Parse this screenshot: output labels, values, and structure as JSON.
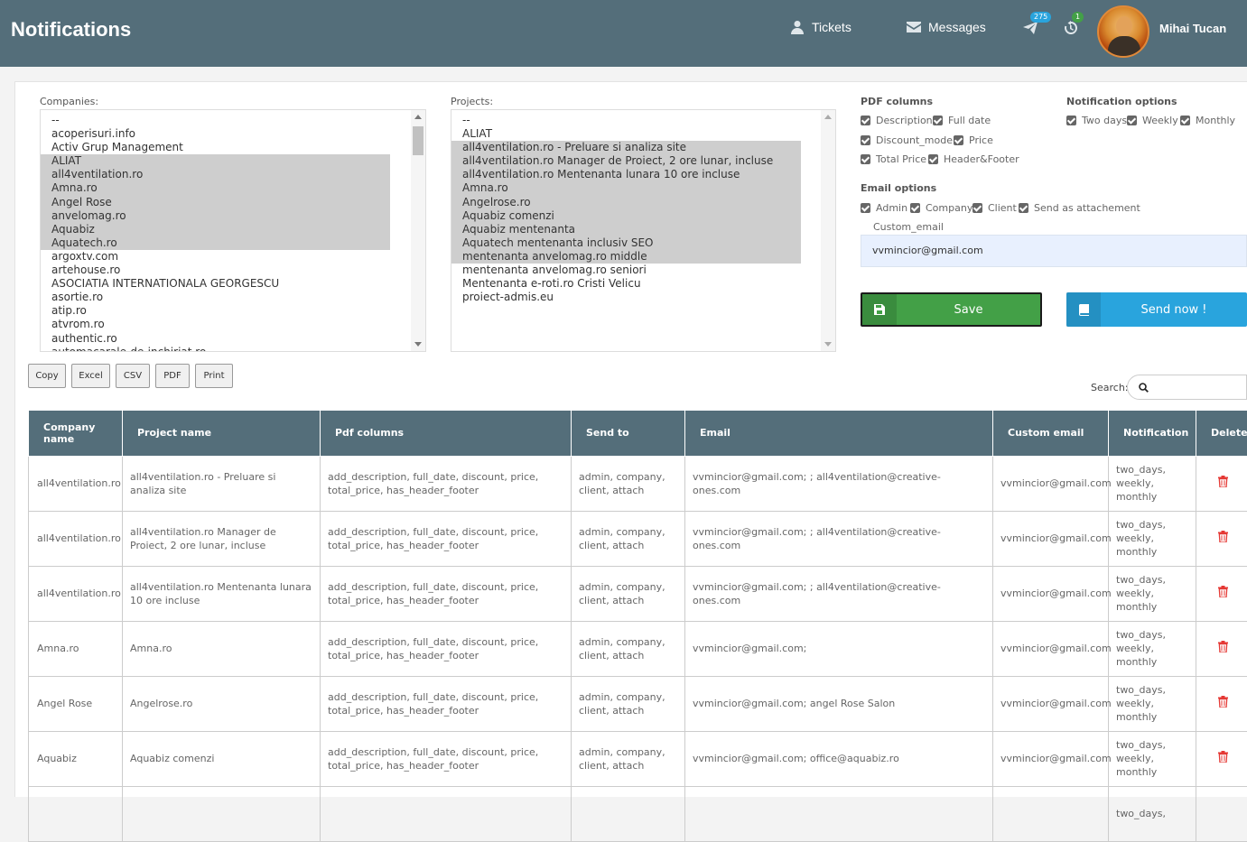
{
  "header": {
    "title": "Notifications",
    "tickets_label": "Tickets",
    "messages_label": "Messages",
    "tasks_badge": "275",
    "history_badge": "1",
    "username": "Mihai Tucan"
  },
  "companies": {
    "label": "Companies:",
    "options": [
      {
        "text": "--",
        "selected": false
      },
      {
        "text": "acoperisuri.info",
        "selected": false
      },
      {
        "text": "Activ Grup Management",
        "selected": false
      },
      {
        "text": "ALIAT",
        "selected": true
      },
      {
        "text": "all4ventilation.ro",
        "selected": true
      },
      {
        "text": "Amna.ro",
        "selected": true
      },
      {
        "text": "Angel Rose",
        "selected": true
      },
      {
        "text": "anvelomag.ro",
        "selected": true
      },
      {
        "text": "Aquabiz",
        "selected": true
      },
      {
        "text": "Aquatech.ro",
        "selected": true
      },
      {
        "text": "argoxtv.com",
        "selected": false
      },
      {
        "text": "artehouse.ro",
        "selected": false
      },
      {
        "text": "ASOCIATIA INTERNATIONALA GEORGESCU",
        "selected": false
      },
      {
        "text": "asortie.ro",
        "selected": false
      },
      {
        "text": "atip.ro",
        "selected": false
      },
      {
        "text": "atvrom.ro",
        "selected": false
      },
      {
        "text": "authentic.ro",
        "selected": false
      },
      {
        "text": "automacarale-de-inchiriat.ro",
        "selected": false
      }
    ]
  },
  "projects": {
    "label": "Projects:",
    "options": [
      {
        "text": "--",
        "selected": false
      },
      {
        "text": "ALIAT",
        "selected": false
      },
      {
        "text": "all4ventilation.ro - Preluare si analiza site",
        "selected": true
      },
      {
        "text": "all4ventilation.ro Manager de Proiect, 2 ore lunar, incluse",
        "selected": true
      },
      {
        "text": "all4ventilation.ro Mentenanta lunara 10 ore incluse",
        "selected": true
      },
      {
        "text": "Amna.ro",
        "selected": true
      },
      {
        "text": "Angelrose.ro",
        "selected": true
      },
      {
        "text": "Aquabiz comenzi",
        "selected": true
      },
      {
        "text": "Aquabiz mentenanta",
        "selected": true
      },
      {
        "text": "Aquatech mentenanta inclusiv SEO",
        "selected": true
      },
      {
        "text": "mentenanta anvelomag.ro middle",
        "selected": true
      },
      {
        "text": "mentenanta anvelomag.ro seniori",
        "selected": false
      },
      {
        "text": "Mentenanta e-roti.ro Cristi Velicu",
        "selected": false
      },
      {
        "text": "proiect-admis.eu",
        "selected": false
      }
    ]
  },
  "pdf_columns": {
    "title": "PDF columns",
    "description": "Description",
    "full_date": "Full date",
    "discount": "Discount_model",
    "price": "Price",
    "total_price": "Total Price",
    "header_footer": "Header&Footer"
  },
  "notification_options": {
    "title": "Notification options",
    "two_days": "Two days",
    "weekly": "Weekly",
    "monthly": "Monthly"
  },
  "email_options": {
    "title": "Email options",
    "admin": "Admin",
    "company": "Company",
    "client": "Client",
    "attach": "Send as attachement",
    "custom_label": "Custom_email",
    "custom_value": "vvmincior@gmail.com"
  },
  "actions": {
    "save": "Save",
    "send": "Send now !"
  },
  "toolbar": {
    "copy": "Copy",
    "excel": "Excel",
    "csv": "CSV",
    "pdf": "PDF",
    "print": "Print",
    "search_label": "Search:"
  },
  "table": {
    "headers": [
      "Company name",
      "Project name",
      "Pdf columns",
      "Send to",
      "Email",
      "Custom email",
      "Notification",
      "Delete"
    ],
    "rows": [
      [
        "all4ventilation.ro",
        "all4ventilation.ro - Preluare si analiza site",
        "add_description, full_date, discount, price, total_price, has_header_footer",
        "admin, company, client, attach",
        "vvmincior@gmail.com; ; all4ventilation@creative-ones.com",
        "vvmincior@gmail.com",
        "two_days, weekly, monthly"
      ],
      [
        "all4ventilation.ro",
        "all4ventilation.ro Manager de Proiect, 2 ore lunar, incluse",
        "add_description, full_date, discount, price, total_price, has_header_footer",
        "admin, company, client, attach",
        "vvmincior@gmail.com; ; all4ventilation@creative-ones.com",
        "vvmincior@gmail.com",
        "two_days, weekly, monthly"
      ],
      [
        "all4ventilation.ro",
        "all4ventilation.ro Mentenanta lunara 10 ore incluse",
        "add_description, full_date, discount, price, total_price, has_header_footer",
        "admin, company, client, attach",
        "vvmincior@gmail.com; ; all4ventilation@creative-ones.com",
        "vvmincior@gmail.com",
        "two_days, weekly, monthly"
      ],
      [
        "Amna.ro",
        "Amna.ro",
        "add_description, full_date, discount, price, total_price, has_header_footer",
        "admin, company, client, attach",
        "vvmincior@gmail.com;",
        "vvmincior@gmail.com",
        "two_days, weekly, monthly"
      ],
      [
        "Angel Rose",
        "Angelrose.ro",
        "add_description, full_date, discount, price, total_price, has_header_footer",
        "admin, company, client, attach",
        "vvmincior@gmail.com; angel Rose Salon",
        "vvmincior@gmail.com",
        "two_days, weekly, monthly"
      ],
      [
        "Aquabiz",
        "Aquabiz comenzi",
        "add_description, full_date, discount, price, total_price, has_header_footer",
        "admin, company, client, attach",
        "vvmincior@gmail.com; office@aquabiz.ro",
        "vvmincior@gmail.com",
        "two_days, weekly, monthly"
      ],
      [
        "",
        "",
        "",
        "",
        "",
        "",
        "two_days,"
      ]
    ]
  },
  "colors": {
    "header_bg": "#546e7a",
    "save_green": "#43a047",
    "send_blue": "#29a4dd",
    "delete_red": "#e53935",
    "tasks_badge": "#29a4dd",
    "history_badge": "#43a047"
  }
}
